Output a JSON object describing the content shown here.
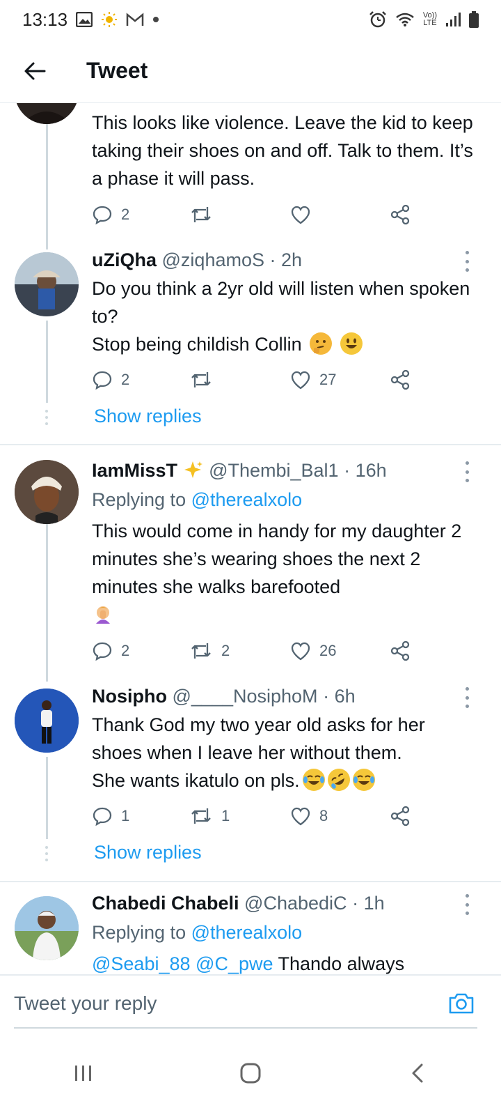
{
  "status_bar": {
    "time": "13:13",
    "volte_top": "Vo))",
    "volte_bottom": "LTE"
  },
  "header": {
    "title": "Tweet"
  },
  "tweets": [
    {
      "text": "This looks like violence. Leave the kid to keep taking their shoes on and off. Talk to them. It’s a phase it will pass.",
      "replies": "2",
      "retweets": "",
      "likes": ""
    },
    {
      "name": "uZiQha",
      "handle": "@ziqhamoS",
      "time": "2h",
      "text_lines": [
        "Do you think a 2yr old will listen when spoken to?",
        "Stop being childish Collin"
      ],
      "emojis": [
        "thinking-face",
        "grinning-face"
      ],
      "replies": "2",
      "retweets": "",
      "likes": "27",
      "show_replies": "Show replies"
    },
    {
      "name": "IamMissT",
      "name_emoji": "sparkles",
      "handle": "@Thembi_Bal1",
      "time": "16h",
      "replying_label": "Replying to",
      "replying_to": "@therealxolo",
      "text": "This would come in handy for my daughter 2 minutes she’s wearing shoes the next 2 minutes she walks barefooted",
      "emojis": [
        "woman-facepalming"
      ],
      "replies": "2",
      "retweets": "2",
      "likes": "26"
    },
    {
      "name": "Nosipho",
      "handle": "@____NosiphoM",
      "time": "6h",
      "text_lines": [
        "Thank God my two year old asks for her",
        "shoes when I leave her without them.",
        "She wants ikatulo on pls."
      ],
      "emojis": [
        "face-with-tears-of-joy",
        "rolling-on-floor-laughing",
        "face-with-tears-of-joy"
      ],
      "replies": "1",
      "retweets": "1",
      "likes": "8",
      "show_replies": "Show replies"
    },
    {
      "name": "Chabedi Chabeli",
      "handle": "@ChabediC",
      "time": "1h",
      "replying_label": "Replying to",
      "replying_to": "@therealxolo",
      "mentions": [
        "@Seabi_88",
        "@C_pwe"
      ],
      "text_tail": "Thando always"
    }
  ],
  "reply_bar": {
    "placeholder": "Tweet your reply"
  },
  "colors": {
    "link": "#1d9bf0",
    "muted": "#536471",
    "text": "#0f1419",
    "divider": "#e6ecf0"
  }
}
